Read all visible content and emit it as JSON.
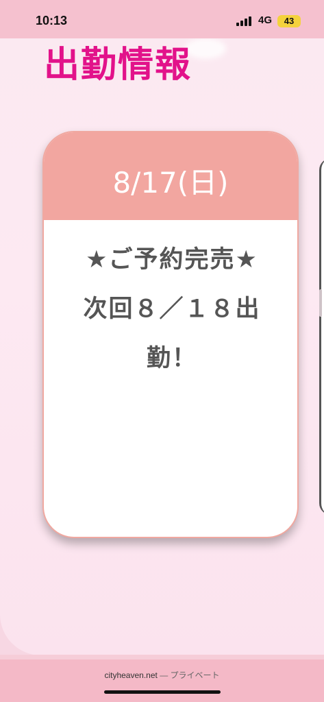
{
  "status_bar": {
    "time": "10:13",
    "network": "4G",
    "battery": "43"
  },
  "page": {
    "section_title": "出勤情報",
    "card": {
      "date": "8/17(日)",
      "message_line1": "★ご予約完売★",
      "message_line2": "次回８／１８出",
      "message_line3": "勤！"
    }
  },
  "browser": {
    "domain": "cityheaven.net",
    "mode": "— プライベート"
  },
  "colors": {
    "title": "#e2128a",
    "card_header": "#f2a6a0",
    "status_bar": "#f5c1cf",
    "battery": "#f4d23c"
  }
}
